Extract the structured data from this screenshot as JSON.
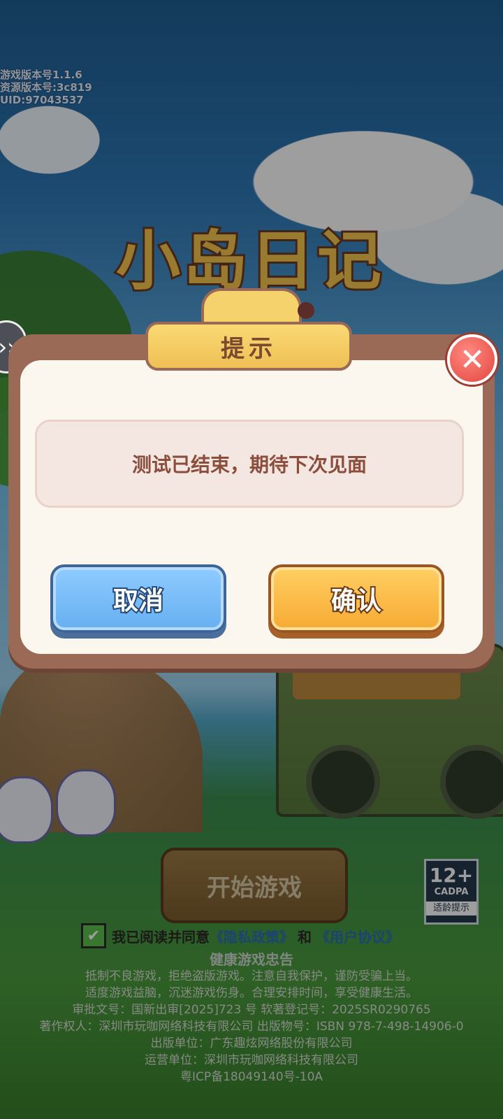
{
  "version": {
    "game_version": "游戏版本号1.1.6",
    "resource_version": "资源版本号:3c819",
    "uid": "UID:97043537"
  },
  "logo_text": "小岛日记",
  "dialog": {
    "title": "提示",
    "message": "测试已结束，期待下次见面",
    "cancel_label": "取消",
    "confirm_label": "确认",
    "close_icon": "✕"
  },
  "start_button_label": "开始游戏",
  "age_rating": {
    "number": "12+",
    "org": "CADPA",
    "tip": "适龄提示"
  },
  "agreement": {
    "checked": true,
    "prefix": "我已阅读并同意",
    "privacy": "《隐私政策》",
    "and": "和",
    "user_agreement": "《用户协议》"
  },
  "health": {
    "title": "健康游戏忠告",
    "lines": [
      "抵制不良游戏，拒绝盗版游戏。注意自我保护，谨防受骗上当。",
      "适度游戏益脑，沉迷游戏伤身。合理安排时间，享受健康生活。",
      "审批文号：国新出审[2025]723 号 软著登记号：2025SR0290765",
      "著作权人：深圳市玩咖网络科技有限公司 出版物号：ISBN 978-7-498-14906-0",
      "出版单位：广东趣炫网络股份有限公司",
      "运营单位：深圳市玩咖网络科技有限公司",
      "粤ICP备18049140号-10A"
    ]
  },
  "colors": {
    "dialog_frame": "#9b6a56",
    "cancel_button": "#66aff0",
    "confirm_button": "#f6aa33",
    "close_button": "#e2453f"
  }
}
